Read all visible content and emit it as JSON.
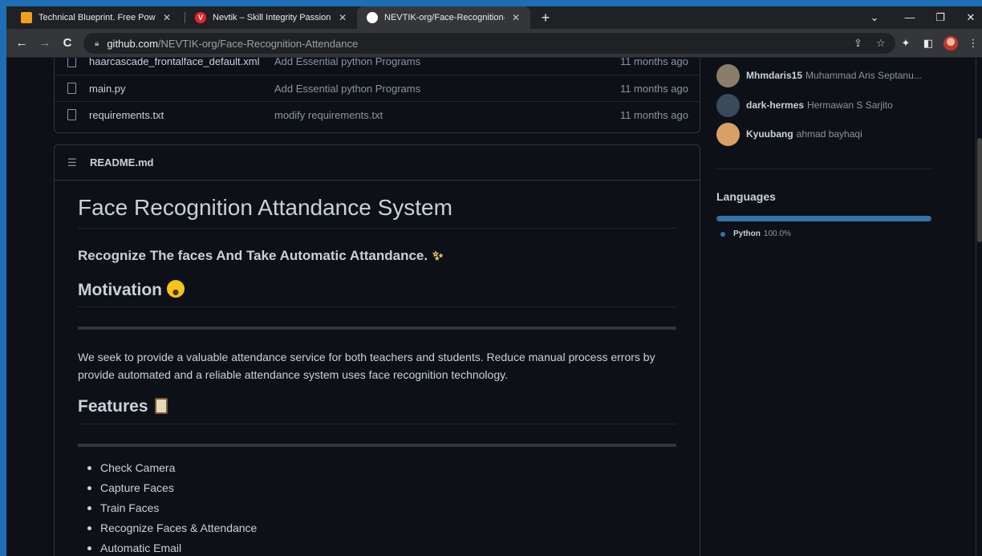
{
  "browser": {
    "tabs": [
      {
        "title": "Technical Blueprint. Free PowerPo",
        "fav_color": "#f0a020"
      },
      {
        "title": "Nevtik – Skill Integrity Passion",
        "fav_color": "#e8242e",
        "fav_glyph": "V"
      },
      {
        "title": "NEVTIK-org/Face-Recognition-At",
        "fav_color": "#ffffff"
      }
    ],
    "close_glyph": "✕",
    "new_tab_glyph": "+",
    "window_controls": {
      "menu": "⌄",
      "minimize": "—",
      "restore": "❐",
      "close": "✕"
    },
    "nav": {
      "back": "←",
      "forward": "→",
      "reload": "C"
    },
    "url": {
      "host": "github.com",
      "path": "/NEVTIK-org/Face-Recognition-Attendance"
    },
    "toolbar_icons": {
      "share": "⇪",
      "bookmark": "☆",
      "extensions": "✦",
      "sidebar": "◧",
      "menu": "⋮"
    }
  },
  "files": [
    {
      "name": "haarcascade_frontalface_default.xml",
      "message": "Add Essential python Programs",
      "date": "11 months ago"
    },
    {
      "name": "main.py",
      "message": "Add Essential python Programs",
      "date": "11 months ago"
    },
    {
      "name": "requirements.txt",
      "message": "modify requirements.txt",
      "date": "11 months ago"
    }
  ],
  "readme": {
    "filename": "README.md",
    "h1": "Face Recognition Attandance System",
    "subtitle": "Recognize The faces And Take Automatic Attandance.",
    "motivation_heading": "Motivation",
    "motivation_text": "We seek to provide a valuable attendance service for both teachers and students. Reduce manual process errors by provide automated and a reliable attendance system uses face recognition technology.",
    "features_heading": "Features",
    "features": [
      "Check Camera",
      "Capture Faces",
      "Train Faces",
      "Recognize Faces & Attendance",
      "Automatic Email"
    ]
  },
  "sidebar": {
    "contributors": [
      {
        "login": "Mhmdaris15",
        "name": "Muhammad Aris Septanu...",
        "avatar_color": "#8a7e6a"
      },
      {
        "login": "dark-hermes",
        "name": "Hermawan S Sarjito",
        "avatar_color": "#3a4a5a"
      },
      {
        "login": "Kyuubang",
        "name": "ahmad bayhaqi",
        "avatar_color": "#d9a066"
      }
    ],
    "languages_heading": "Languages",
    "languages": [
      {
        "name": "Python",
        "percent": "100.0%",
        "fraction": 1.0,
        "color": "#3572a5"
      }
    ]
  }
}
